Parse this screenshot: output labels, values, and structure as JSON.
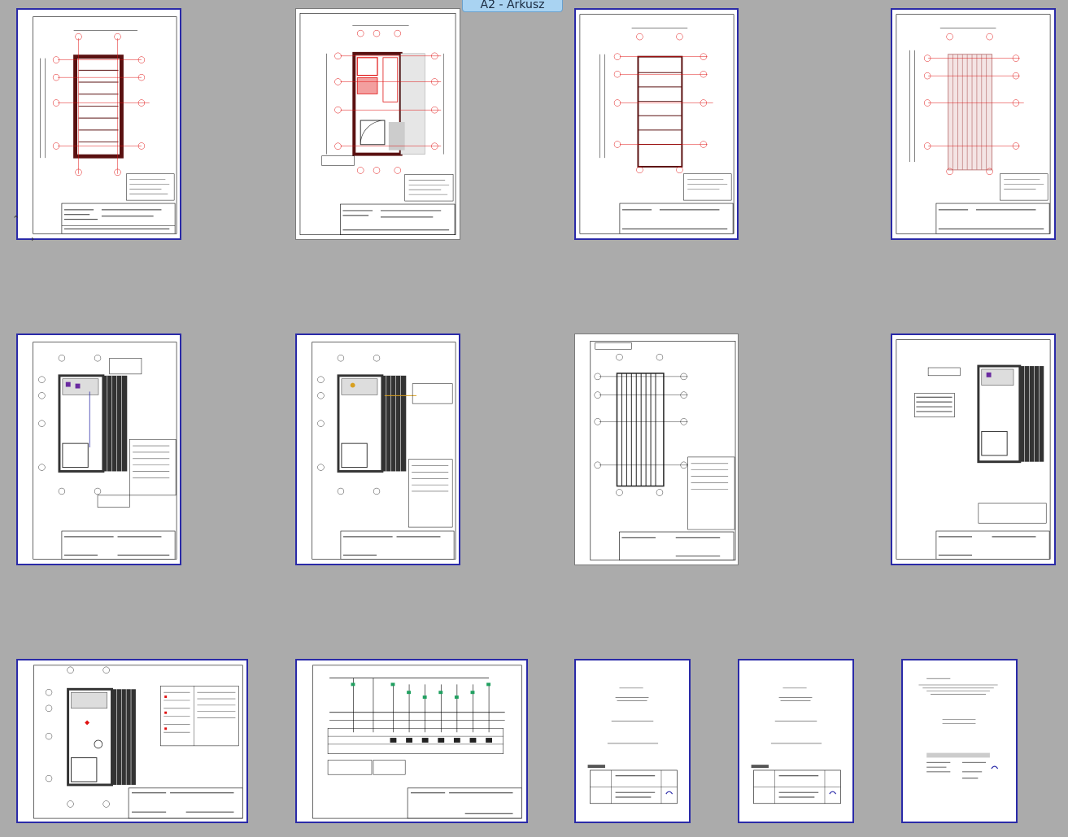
{
  "tooltip": {
    "label": "A2 - Arkusz"
  },
  "sheets": [
    {
      "id": "s1",
      "selected": true
    },
    {
      "id": "s2",
      "selected": false
    },
    {
      "id": "s3",
      "selected": true
    },
    {
      "id": "s4",
      "selected": true
    },
    {
      "id": "s5",
      "selected": true
    },
    {
      "id": "s6",
      "selected": true
    },
    {
      "id": "s7",
      "selected": false
    },
    {
      "id": "s8",
      "selected": true
    },
    {
      "id": "s9",
      "selected": true
    },
    {
      "id": "s10",
      "selected": true
    },
    {
      "id": "s11",
      "selected": true
    },
    {
      "id": "s12",
      "selected": true
    },
    {
      "id": "s13",
      "selected": true
    }
  ],
  "colors": {
    "selection": "#2a2aa8",
    "annotation": "#e01010",
    "background": "#ababab"
  },
  "icons": {
    "collapse": "chevron-up-icon",
    "expand": "chevron-right-icon"
  }
}
